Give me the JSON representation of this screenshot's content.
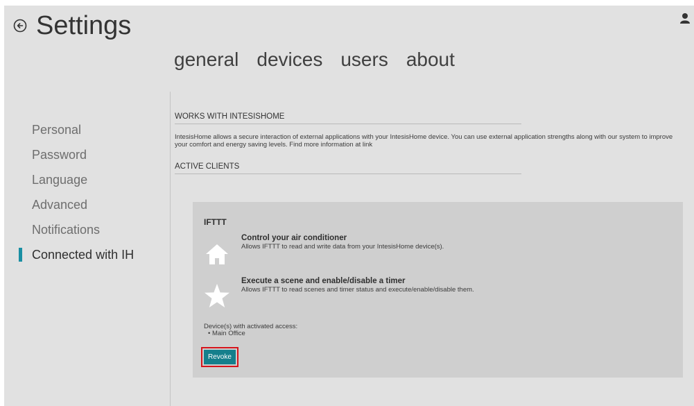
{
  "header": {
    "title": "Settings",
    "back_icon": "circle-arrow-left-icon",
    "user_icon": "user-icon"
  },
  "tabs": [
    {
      "label": "general"
    },
    {
      "label": "devices"
    },
    {
      "label": "users"
    },
    {
      "label": "about"
    }
  ],
  "sidebar": {
    "items": [
      {
        "label": "Personal"
      },
      {
        "label": "Password"
      },
      {
        "label": "Language"
      },
      {
        "label": "Advanced"
      },
      {
        "label": "Notifications"
      },
      {
        "label": "Connected with IH",
        "active": true
      }
    ],
    "accent_color": "#1a8fa3"
  },
  "main": {
    "works_with_title": "WORKS WITH INTESISHOME",
    "works_with_desc": "IntesisHome allows a secure interaction of external applications with your IntesisHome device. You can use external application strengths along with our system to improve your comfort and energy saving levels. Find more information at link",
    "active_clients_title": "ACTIVE CLIENTS"
  },
  "client": {
    "name": "IFTTT",
    "permissions": [
      {
        "icon": "house-icon",
        "title": "Control your air conditioner",
        "desc": "Allows IFTTT to read and write data from your IntesisHome device(s)."
      },
      {
        "icon": "star-icon",
        "title": "Execute a scene and enable/disable a timer",
        "desc": "Allows IFTTT to read scenes and timer status and execute/enable/disable them."
      }
    ],
    "access_label": "Device(s) with activated access:",
    "devices": [
      "Main Office"
    ],
    "revoke_label": "Revoke",
    "revoke_color": "#157f8c",
    "highlight_color": "#d6141b"
  }
}
